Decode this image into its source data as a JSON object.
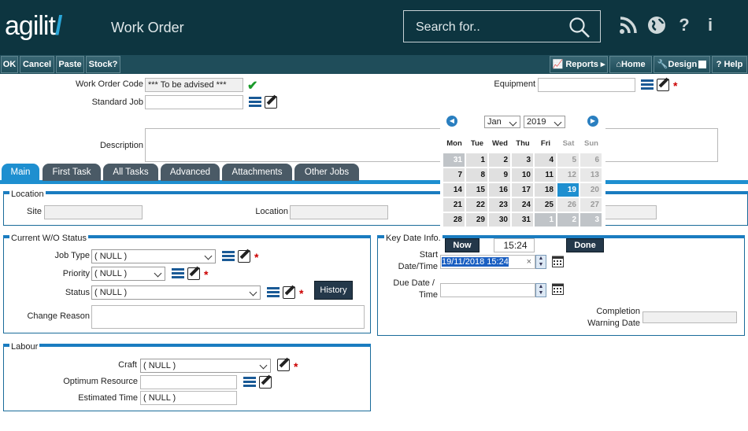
{
  "app": {
    "logo": "agilit",
    "title": "Work Order",
    "search_placeholder": "Search for.."
  },
  "toolbar": {
    "ok": "OK",
    "cancel": "Cancel",
    "paste": "Paste",
    "stock": "Stock?",
    "reports": "Reports",
    "home": "Home",
    "design": "Design",
    "help": "Help"
  },
  "header_fields": {
    "wo_code_label": "Work Order Code",
    "wo_code_value": "*** To be advised ***",
    "standard_job_label": "Standard Job",
    "equipment_label": "Equipment",
    "description_label": "Description"
  },
  "tabs": [
    "Main",
    "First Task",
    "All Tasks",
    "Advanced",
    "Attachments",
    "Other Jobs"
  ],
  "location": {
    "legend": "Location",
    "site_label": "Site",
    "location_label": "Location"
  },
  "status": {
    "legend": "Current W/O Status",
    "job_type_label": "Job Type",
    "job_type_value": "( NULL )",
    "priority_label": "Priority",
    "priority_value": "( NULL )",
    "status_label": "Status",
    "status_value": "( NULL )",
    "history_button": "History",
    "change_reason_label": "Change Reason"
  },
  "key_date": {
    "legend": "Key Date Info.",
    "start_label_1": "Start",
    "start_label_2": "Date/Time",
    "start_value": "19/11/2018 15:24",
    "due_label_1": "Due Date /",
    "due_label_2": "Time",
    "completion_label_1": "Completion",
    "completion_label_2": "Warning Date"
  },
  "labour": {
    "legend": "Labour",
    "craft_label": "Craft",
    "craft_value": "( NULL )",
    "optimum_label": "Optimum Resource",
    "estimated_label": "Estimated Time",
    "estimated_value": "( NULL )"
  },
  "calendar": {
    "month": "Jan",
    "year": "2019",
    "weekdays": [
      "Mon",
      "Tue",
      "Wed",
      "Thu",
      "Fri",
      "Sat",
      "Sun"
    ],
    "weeks": [
      [
        "31",
        "1",
        "2",
        "3",
        "4",
        "5",
        "6"
      ],
      [
        "7",
        "8",
        "9",
        "10",
        "11",
        "12",
        "13"
      ],
      [
        "14",
        "15",
        "16",
        "17",
        "18",
        "19",
        "20"
      ],
      [
        "21",
        "22",
        "23",
        "24",
        "25",
        "26",
        "27"
      ],
      [
        "28",
        "29",
        "30",
        "31",
        "1",
        "2",
        "3"
      ]
    ],
    "selected_day": "19",
    "time": "15:24",
    "now_button": "Now",
    "done_button": "Done"
  },
  "colors": {
    "header_bg": "#0d3540",
    "accent": "#1e8fd0",
    "required": "#cc0000"
  }
}
